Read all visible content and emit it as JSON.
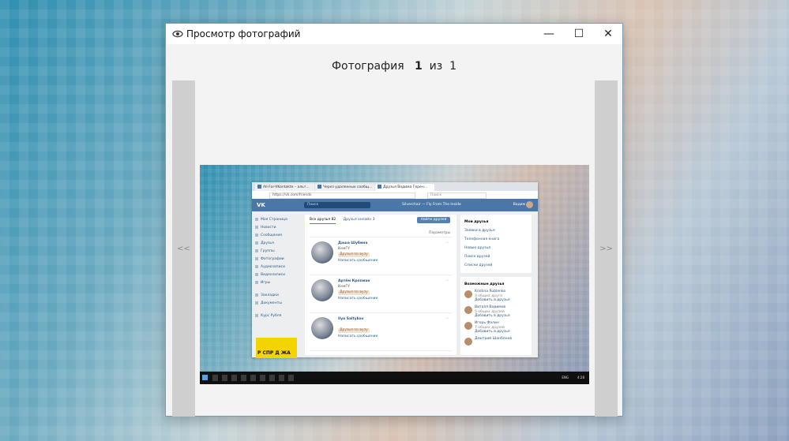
{
  "window": {
    "title": "Просмотр фотографий",
    "minimize": "—",
    "maximize": "☐",
    "close": "✕"
  },
  "counter": {
    "prefix": "Фотография",
    "current": "1",
    "separator": "из",
    "total": "1"
  },
  "nav": {
    "prev": "<<",
    "next": ">>"
  },
  "photo": {
    "browser": {
      "tabs": [
        {
          "label": "All-For-VKontakte – альт..."
        },
        {
          "label": "Через удаленных сообщ..."
        },
        {
          "label": "Друзья Вадима Герен..."
        }
      ],
      "url": "https://vk.com/friends",
      "search_placeholder": "Поиск",
      "vk": {
        "logo": "VK",
        "search_placeholder": "Поиск",
        "player": "Silverchair — Fly From The Inside",
        "user": "Вадим",
        "menu": [
          "Моя Страница",
          "Новости",
          "Сообщения",
          "Друзья",
          "Группы",
          "Фотографии",
          "Аудиозаписи",
          "Видеозаписи",
          "Игры",
          "Закладки",
          "Документы",
          "Курс Рубля"
        ],
        "ad_text": "Р СПР Д ЖА",
        "friends_tabs": {
          "all": "Все друзья 82",
          "online": "Друзья онлайн 3"
        },
        "find_button": "Найти друзей",
        "search_params": "Параметры",
        "friends": [
          {
            "name": "Даша Шубина",
            "sub": "КемГУ",
            "badge": "Друзья по вузу",
            "message": "Написать сообщение"
          },
          {
            "name": "Артём Кропман",
            "sub": "КемГУ",
            "badge": "Друзья по вузу",
            "message": "Написать сообщение"
          },
          {
            "name": "Ilya Saltykov",
            "sub": "",
            "badge": "Друзья по вузу",
            "message": "Написать сообщение"
          }
        ],
        "right_menu": [
          "Мои друзья",
          "Заявки в друзья",
          "Телефонная книга",
          "Новые друзья",
          "Поиск друзей",
          "Списки друзей"
        ],
        "possible_title": "Возможные друзья",
        "possible": [
          {
            "name": "Kristina Rublenko",
            "mutual": "3 общих друга",
            "add": "Добавить в друзья"
          },
          {
            "name": "Виталя Вадимов",
            "mutual": "5 общих друзей",
            "add": "Добавить в друзья"
          },
          {
            "name": "Игорь Фалин",
            "mutual": "7 общих друзей",
            "add": "Добавить в друзья"
          },
          {
            "name": "Дмитрий Шанбонов",
            "mutual": "",
            "add": ""
          }
        ]
      }
    },
    "taskbar": {
      "lang": "ENG",
      "time": "4:28"
    }
  }
}
